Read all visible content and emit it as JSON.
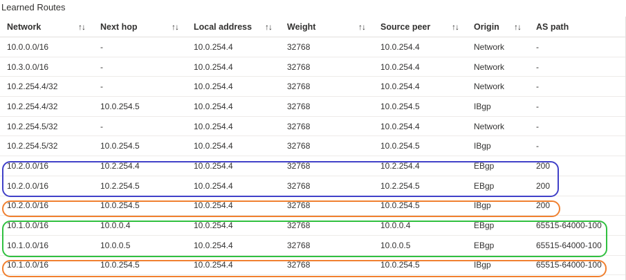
{
  "panel": {
    "title": "Learned Routes"
  },
  "columns": [
    "Network",
    "Next hop",
    "Local address",
    "Weight",
    "Source peer",
    "Origin",
    "AS path"
  ],
  "sort_icon": "sort-arrows-icon",
  "sort_glyph": "↑↓",
  "rows": [
    [
      "10.0.0.0/16",
      "-",
      "10.0.254.4",
      "32768",
      "10.0.254.4",
      "Network",
      "-"
    ],
    [
      "10.3.0.0/16",
      "-",
      "10.0.254.4",
      "32768",
      "10.0.254.4",
      "Network",
      "-"
    ],
    [
      "10.2.254.4/32",
      "-",
      "10.0.254.4",
      "32768",
      "10.0.254.4",
      "Network",
      "-"
    ],
    [
      "10.2.254.4/32",
      "10.0.254.5",
      "10.0.254.4",
      "32768",
      "10.0.254.5",
      "IBgp",
      "-"
    ],
    [
      "10.2.254.5/32",
      "-",
      "10.0.254.4",
      "32768",
      "10.0.254.4",
      "Network",
      "-"
    ],
    [
      "10.2.254.5/32",
      "10.0.254.5",
      "10.0.254.4",
      "32768",
      "10.0.254.5",
      "IBgp",
      "-"
    ],
    [
      "10.2.0.0/16",
      "10.2.254.4",
      "10.0.254.4",
      "32768",
      "10.2.254.4",
      "EBgp",
      "200"
    ],
    [
      "10.2.0.0/16",
      "10.2.254.5",
      "10.0.254.4",
      "32768",
      "10.2.254.5",
      "EBgp",
      "200"
    ],
    [
      "10.2.0.0/16",
      "10.0.254.5",
      "10.0.254.4",
      "32768",
      "10.0.254.5",
      "IBgp",
      "200"
    ],
    [
      "10.1.0.0/16",
      "10.0.0.4",
      "10.0.254.4",
      "32768",
      "10.0.0.4",
      "EBgp",
      "65515-64000-100"
    ],
    [
      "10.1.0.0/16",
      "10.0.0.5",
      "10.0.254.4",
      "32768",
      "10.0.0.5",
      "EBgp",
      "65515-64000-100"
    ],
    [
      "10.1.0.0/16",
      "10.0.254.5",
      "10.0.254.4",
      "32768",
      "10.0.254.5",
      "IBgp",
      "65515-64000-100"
    ]
  ],
  "highlight_colors": {
    "blue": "#4040c8",
    "orange": "#f08030",
    "green": "#30c040"
  }
}
